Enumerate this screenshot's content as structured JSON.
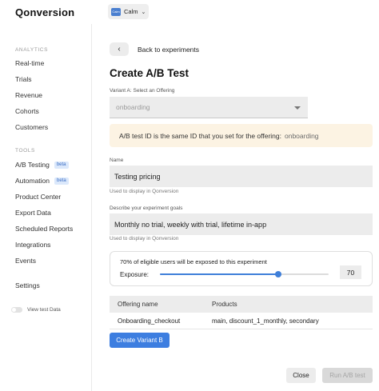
{
  "app": {
    "logo": "Qonversion",
    "switcher": {
      "icon_text": "Calm",
      "name": "Calm",
      "chevron": "⌄"
    }
  },
  "sidebar": {
    "analytics_heading": "ANALYTICS",
    "analytics_items": [
      {
        "label": "Real-time"
      },
      {
        "label": "Trials"
      },
      {
        "label": "Revenue"
      },
      {
        "label": "Cohorts"
      },
      {
        "label": "Customers"
      }
    ],
    "tools_heading": "TOOLS",
    "tools_items": [
      {
        "label": "A/B Testing",
        "badge": "beta"
      },
      {
        "label": "Automation",
        "badge": "beta"
      },
      {
        "label": "Product Center"
      },
      {
        "label": "Export Data"
      },
      {
        "label": "Scheduled Reports"
      },
      {
        "label": "Integrations"
      },
      {
        "label": "Events"
      }
    ],
    "settings_label": "Settings",
    "view_test_data_label": "View test Data",
    "view_test_data_on": false
  },
  "main": {
    "back_label": "Back to experiments",
    "back_icon": "‹",
    "title": "Create A/B Test",
    "variant_label": "Variant A: Select an Offering",
    "variant_value": "onboarding",
    "info_text": "A/B test ID is the same ID that you set for the offering:",
    "info_highlight": "onboarding",
    "name_label": "Name",
    "name_value": "Testing pricing",
    "name_helper": "Used to display in Qonversion",
    "goals_label": "Describe your experiment goals",
    "goals_value": "Monthly no trial, weekly with trial, lifetime in-app",
    "goals_helper": "Used to display in Qonversion",
    "exposure": {
      "text": "70% of eligible users will be exposed to this experiment",
      "label": "Exposure:",
      "value": "70",
      "percent": 70
    },
    "table": {
      "headers": [
        "Offering name",
        "Products"
      ],
      "rows": [
        {
          "offering": "Onboarding_checkout",
          "products": "main, discount_1_monthly, secondary"
        }
      ]
    },
    "create_variant_label": "Create Variant B",
    "close_label": "Close",
    "run_label": "Run A/B test"
  },
  "colors": {
    "accent": "#3d7ee0",
    "info_bg": "#fcf3e3",
    "beta_bg": "#dbe8fb",
    "beta_text": "#3d6fc4"
  }
}
